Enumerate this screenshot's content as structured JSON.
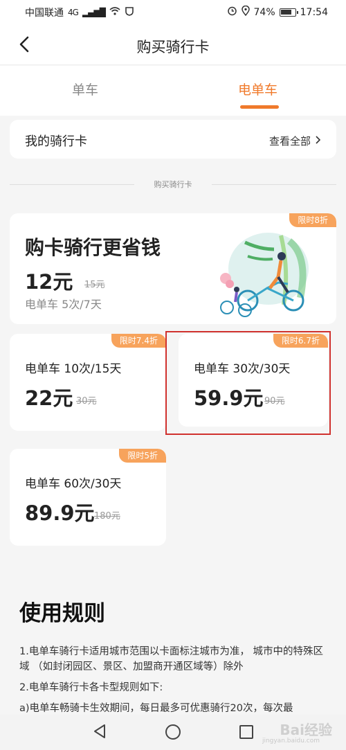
{
  "status_bar": {
    "carrier": "中国联通",
    "network": "4G",
    "battery_pct": "74%",
    "time": "17:54"
  },
  "header": {
    "title": "购买骑行卡",
    "back_icon": "chevron-left-icon"
  },
  "tabs": [
    {
      "label": "单车",
      "active": false
    },
    {
      "label": "电单车",
      "active": true
    }
  ],
  "my_cards": {
    "title": "我的骑行卡",
    "link": "查看全部"
  },
  "section_label": "购买骑行卡",
  "featured_card": {
    "badge": "限时8折",
    "headline": "购卡骑行更省钱",
    "price": "12元",
    "old_price": "15元",
    "desc": "电单车 5次/7天"
  },
  "cards": [
    {
      "badge": "限时7.4折",
      "name": "电单车 10次/15天",
      "price": "22元",
      "old_price": "30元"
    },
    {
      "badge": "限时6.7折",
      "name": "电单车 30次/30天",
      "price": "59.9元",
      "old_price": "90元"
    },
    {
      "badge": "限时5折",
      "name": "电单车 60次/30天",
      "price": "89.9元",
      "old_price": "180元"
    }
  ],
  "rules": {
    "title": "使用规则",
    "items": [
      "1.电单车骑行卡适用城市范围以卡面标注城市为准， 城市中的特殊区域 （如封闭园区、景区、加盟商开通区域等）除外",
      "2.电单车骑行卡各卡型规则如下:",
      "a)电单车畅骑卡生效期间，每日最多可优惠骑行20次，每次最"
    ]
  },
  "watermark": {
    "text": "Bai经验",
    "sub": "jingyan.baidu.com"
  },
  "colors": {
    "accent": "#f07a2b",
    "badge": "#f7a35c",
    "highlight": "#d0312d"
  }
}
